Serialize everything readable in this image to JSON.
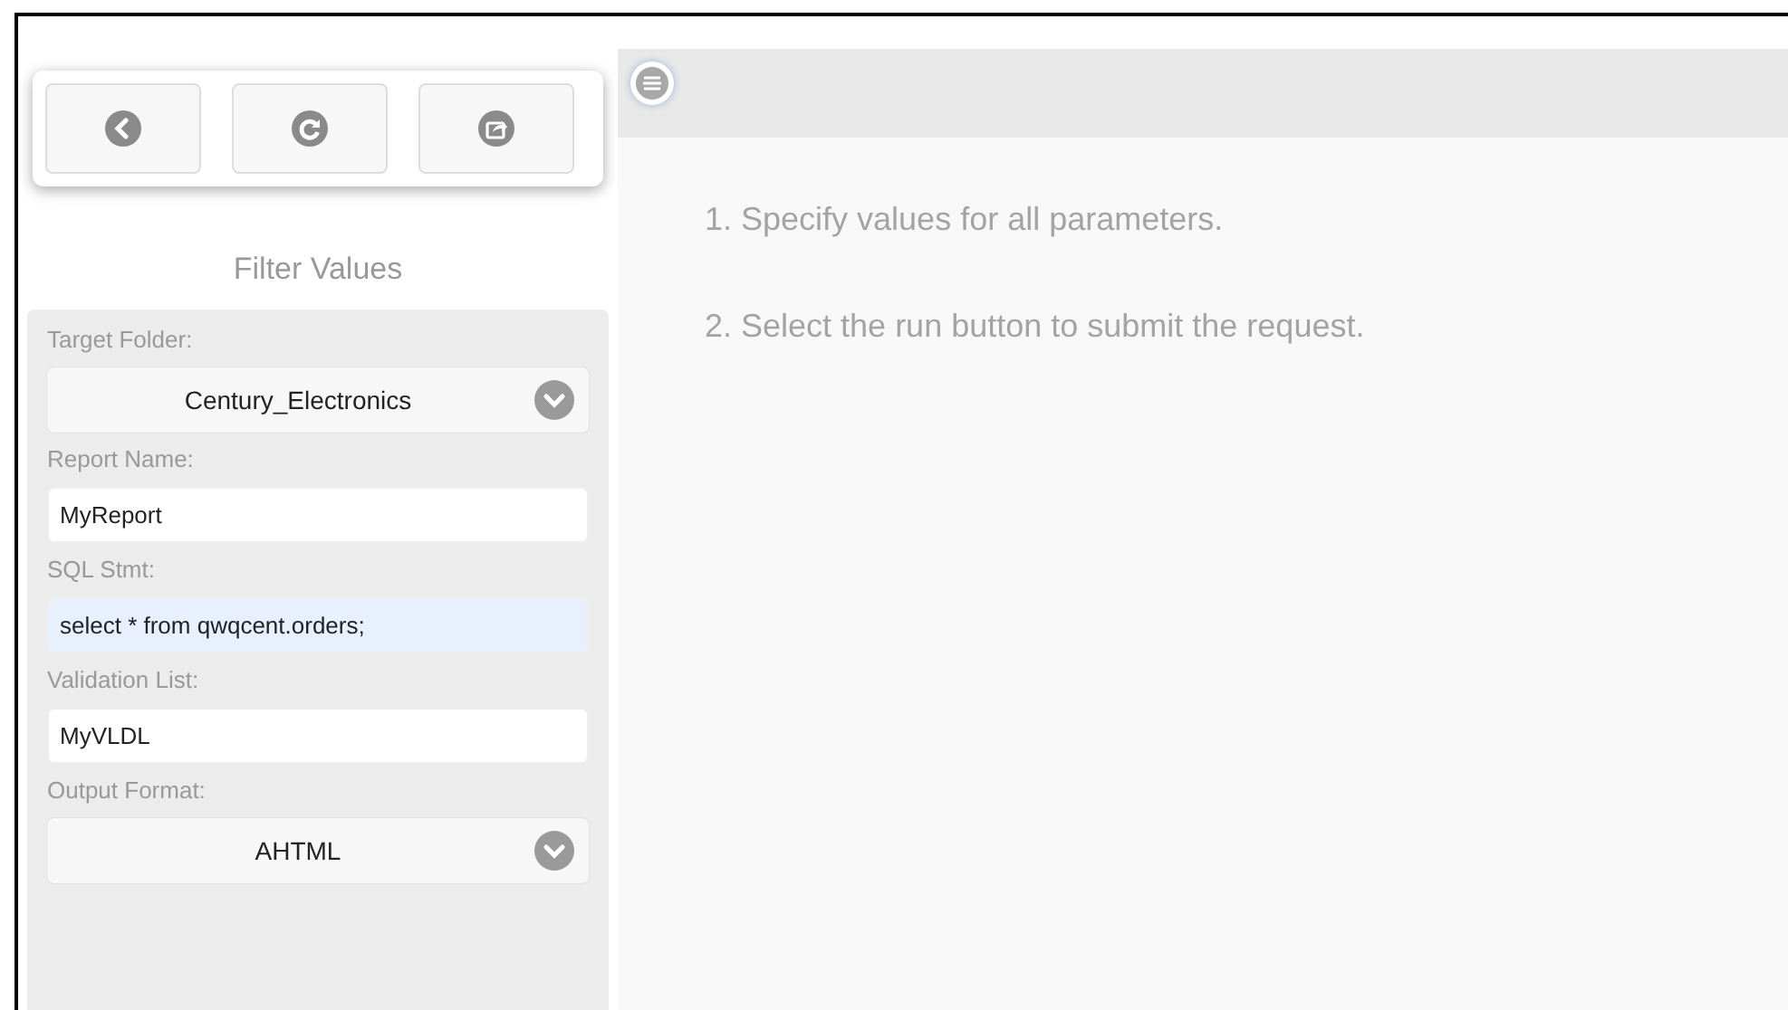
{
  "toolbar": {
    "buttons": [
      {
        "kind": "back"
      },
      {
        "kind": "refresh"
      },
      {
        "kind": "export"
      }
    ]
  },
  "filter_panel": {
    "title": "Filter Values",
    "fields": [
      {
        "label": "Target Folder:",
        "kind": "select",
        "value": "Century_Electronics",
        "focused": false
      },
      {
        "label": "Report Name:",
        "kind": "text",
        "value": "MyReport",
        "focused": false
      },
      {
        "label": "SQL Stmt:",
        "kind": "text",
        "value": "select * from qwqcent.orders;",
        "focused": true
      },
      {
        "label": "Validation List:",
        "kind": "text",
        "value": "MyVLDL",
        "focused": false
      },
      {
        "label": "Output Format:",
        "kind": "select",
        "value": "AHTML",
        "focused": false
      }
    ]
  },
  "instructions": [
    "1. Specify values for all parameters.",
    "2. Select the run button to submit the request."
  ]
}
